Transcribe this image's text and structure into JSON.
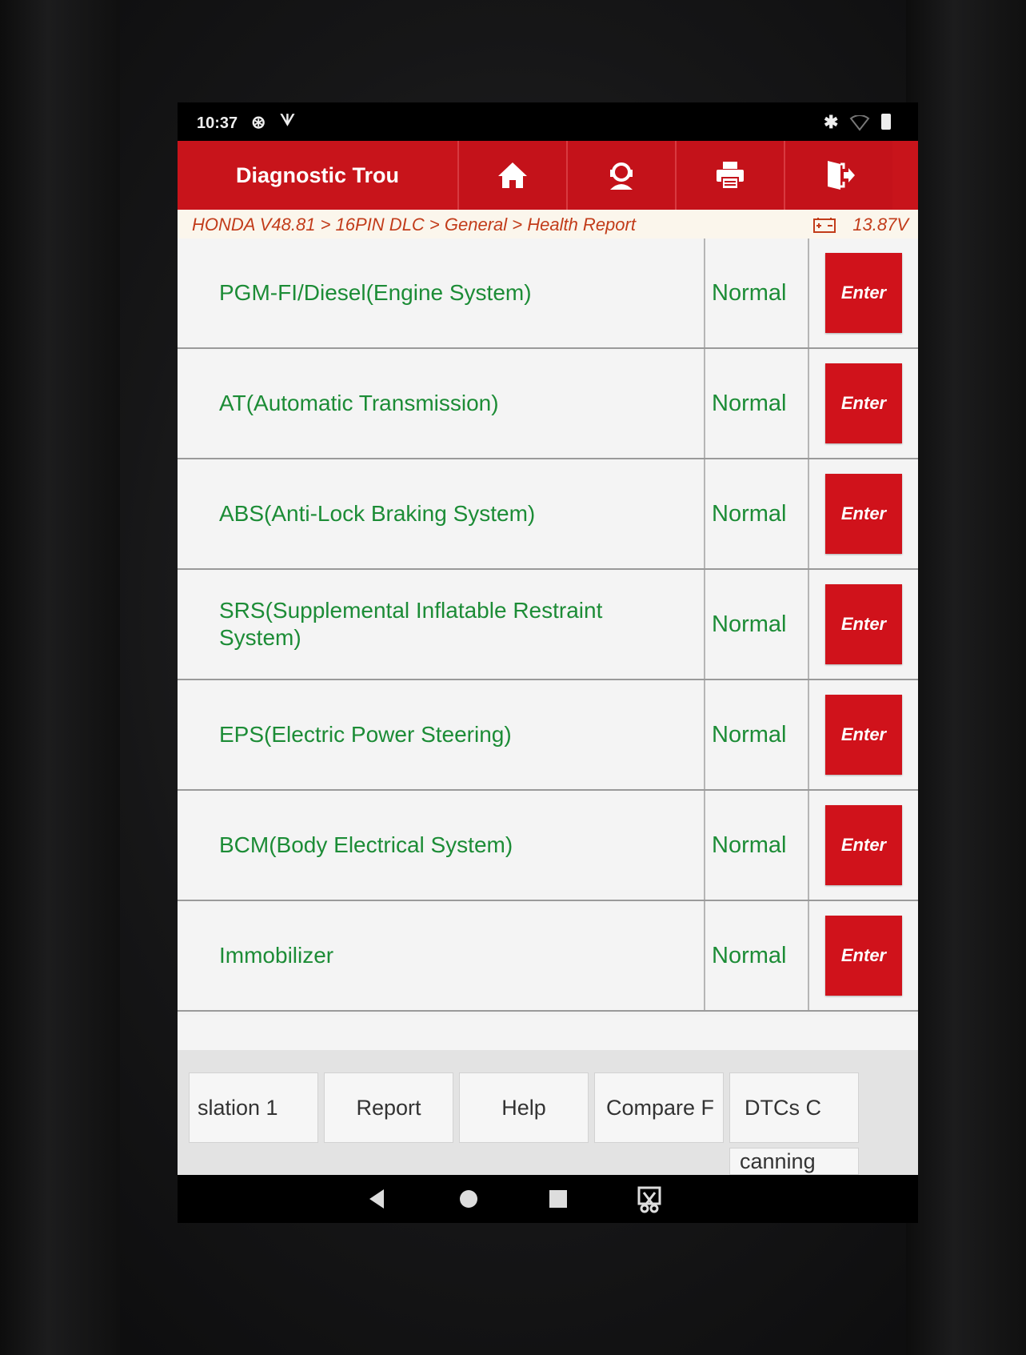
{
  "status_bar": {
    "time": "10:37"
  },
  "header": {
    "title": "Diagnostic Trou",
    "buttons": [
      "home-icon",
      "support-icon",
      "print-icon",
      "exit-icon"
    ]
  },
  "breadcrumb": {
    "path": "HONDA V48.81 > 16PIN DLC > General > Health Report",
    "voltage": "13.87V"
  },
  "systems": [
    {
      "name": "PGM-FI/Diesel(Engine System)",
      "status": "Normal",
      "action": "Enter"
    },
    {
      "name": "AT(Automatic Transmission)",
      "status": "Normal",
      "action": "Enter"
    },
    {
      "name": "ABS(Anti-Lock Braking System)",
      "status": "Normal",
      "action": "Enter"
    },
    {
      "name": "SRS(Supplemental Inflatable Restraint System)",
      "status": "Normal",
      "action": "Enter"
    },
    {
      "name": "EPS(Electric Power Steering)",
      "status": "Normal",
      "action": "Enter"
    },
    {
      "name": "BCM(Body Electrical System)",
      "status": "Normal",
      "action": "Enter"
    },
    {
      "name": "Immobilizer",
      "status": "Normal",
      "action": "Enter"
    }
  ],
  "footer_buttons": [
    "slation   1",
    "Report",
    "Help",
    "Compare F",
    "DTCs   C",
    "canning"
  ],
  "colors": {
    "brand_red": "#c8141b",
    "status_green": "#1c8c36",
    "crumb_orange": "#c23c1a"
  }
}
